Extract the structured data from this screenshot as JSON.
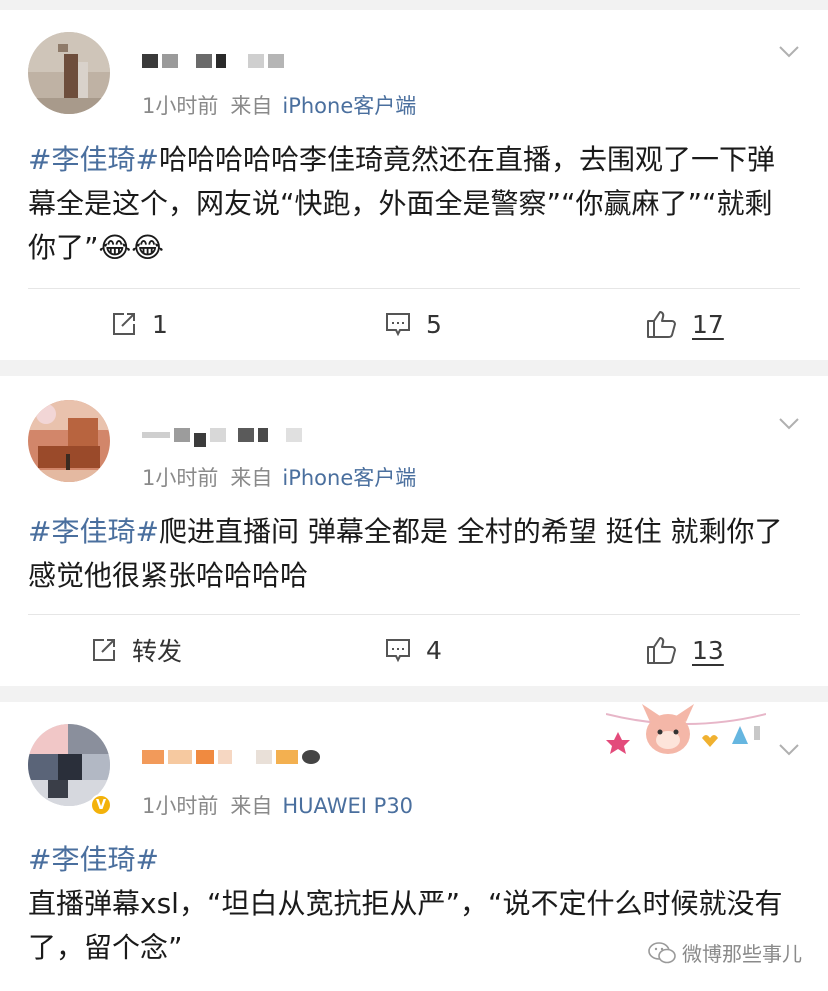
{
  "posts": [
    {
      "time": "1小时前",
      "from_prefix": "来自",
      "source": "iPhone客户端",
      "hashtag": "#李佳琦#",
      "body": "哈哈哈哈哈李佳琦竟然还在直播，去围观了一下弹幕全是这个，网友说“快跑，外面全是警察”“你赢麻了”“就剩你了”",
      "emoji": "😂😂",
      "repost": "1",
      "comments": "5",
      "likes": "17"
    },
    {
      "time": "1小时前",
      "from_prefix": "来自",
      "source": "iPhone客户端",
      "hashtag": "#李佳琦#",
      "body": "爬进直播间 弹幕全都是 全村的希望 挺住 就剩你了 感觉他很紧张哈哈哈哈",
      "repost": "转发",
      "comments": "4",
      "likes": "13"
    },
    {
      "time": "1小时前",
      "from_prefix": "来自",
      "source": "HUAWEI P30",
      "hashtag": "#李佳琦#",
      "body": "直播弹幕xsl，“坦白从宽抗拒从严”，“说不定什么时候就没有了，留个念”"
    }
  ],
  "watermark": "微博那些事儿",
  "colors": {
    "link": "#4a6f9e",
    "meta": "#8a8a8a",
    "background": "#f2f2f2",
    "verified": "#f3b20b"
  },
  "icons": [
    "chevron-down-icon",
    "repost-icon",
    "comment-icon",
    "like-icon",
    "verified-badge-icon",
    "wechat-icon"
  ]
}
